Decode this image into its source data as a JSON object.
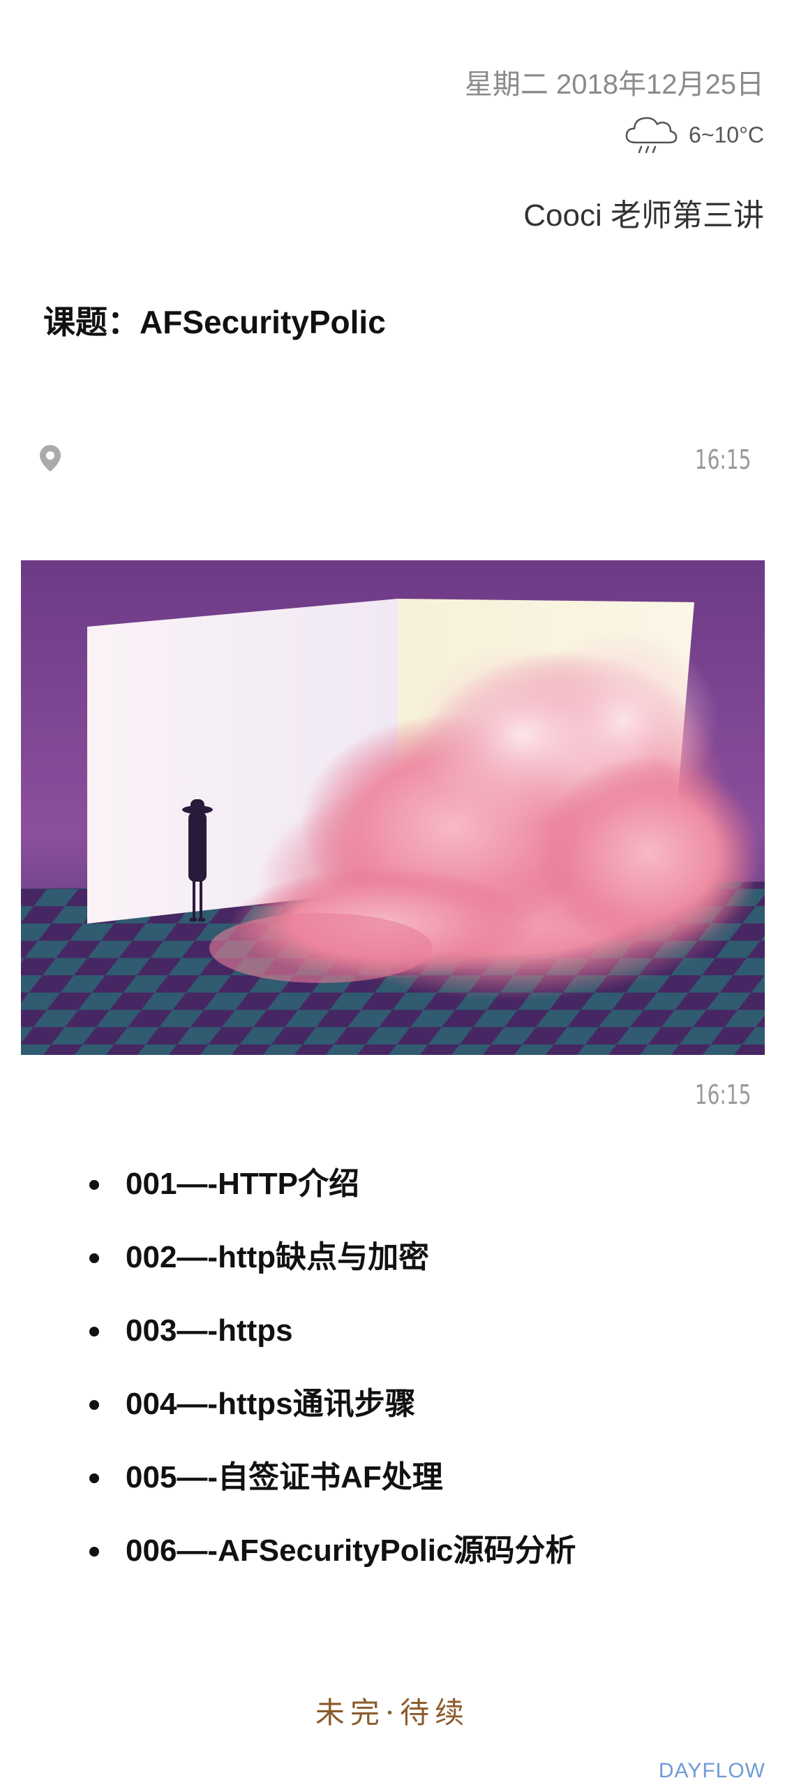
{
  "header": {
    "date": "星期二 2018年12月25日",
    "weather": {
      "icon": "rain-cloud-icon",
      "temperature": "6~10°C"
    },
    "author": "Cooci 老师第三讲"
  },
  "entry": {
    "topic": "课题：AFSecurityPolic",
    "location_icon": "location-pin-icon",
    "time": "16:15",
    "image_time": "16:15"
  },
  "list": {
    "items": [
      "001—-HTTP介绍",
      "002—-http缺点与加密",
      "003—-https",
      "004—-https通讯步骤",
      "005—-自签证书AF处理",
      "006—-AFSecurityPolic源码分析"
    ]
  },
  "footer": {
    "status": "未完·待续",
    "brand": "DAYFLOW"
  },
  "colors": {
    "accent_brown": "#8b5a2b",
    "brand_blue": "#6f9bd6",
    "muted_gray": "#8a8a8a"
  }
}
